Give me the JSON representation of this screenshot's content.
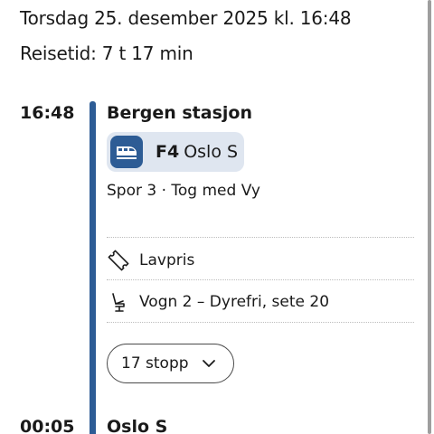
{
  "header": {
    "date_time": "Torsdag 25. desember 2025 kl. 16:48",
    "travel_time": "Reisetid: 7 t 17 min"
  },
  "departure": {
    "time": "16:48",
    "station": "Bergen stasjon",
    "line": {
      "code": "F4",
      "destination": "Oslo S",
      "icon": "train-icon",
      "color": "#2d5c95",
      "chip_color": "#dfe6f0"
    },
    "platform_info": "Spor 3 · Tog med Vy"
  },
  "details": {
    "fare": {
      "icon": "ticket-icon",
      "label": "Lavpris"
    },
    "seat": {
      "icon": "seat-icon",
      "label": "Vogn 2 – Dyrefri, sete 20"
    }
  },
  "stops_button": {
    "label": "17 stopp",
    "icon": "chevron-down-icon"
  },
  "arrival": {
    "time": "00:05",
    "station": "Oslo S"
  }
}
